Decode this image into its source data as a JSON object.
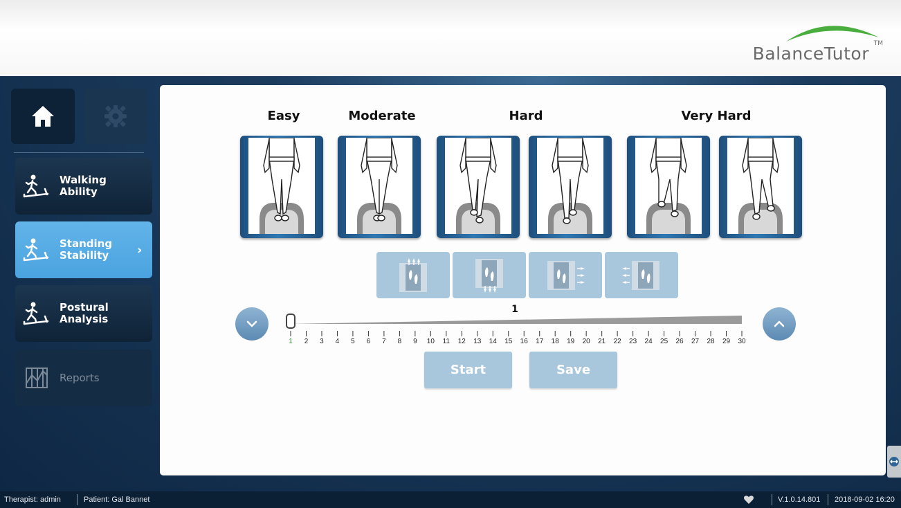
{
  "brand": {
    "name": "BalanceTutor",
    "trademark": "TM",
    "accent": "#3aa33a"
  },
  "sidebar": {
    "home_icon": "home-icon",
    "settings_icon": "gear-icon",
    "items": [
      {
        "label": "Walking Ability",
        "icon": "treadmill-icon",
        "state": "normal"
      },
      {
        "label": "Standing Stability",
        "icon": "treadmill-icon",
        "state": "active",
        "chevron": "›"
      },
      {
        "label": "Postural Analysis",
        "icon": "treadmill-icon",
        "state": "normal"
      },
      {
        "label": "Reports",
        "icon": "chart-icon",
        "state": "disabled"
      }
    ]
  },
  "levels": {
    "titles": [
      "Easy",
      "Moderate",
      "Hard",
      "Very Hard"
    ],
    "cards": [
      {
        "label": "easy-stance-card"
      },
      {
        "label": "moderate-stance-card"
      },
      {
        "label": "hard-stance-card-1"
      },
      {
        "label": "hard-stance-card-2"
      },
      {
        "label": "very-hard-stance-card-1"
      },
      {
        "label": "very-hard-stance-card-2"
      }
    ]
  },
  "directions": [
    "forward",
    "backward",
    "right",
    "left"
  ],
  "slider": {
    "value": "1",
    "min": 1,
    "max": 30,
    "ticks": [
      "1",
      "2",
      "3",
      "4",
      "5",
      "6",
      "7",
      "8",
      "9",
      "10",
      "11",
      "12",
      "13",
      "14",
      "15",
      "16",
      "17",
      "18",
      "19",
      "20",
      "21",
      "22",
      "23",
      "24",
      "25",
      "26",
      "27",
      "28",
      "29",
      "30"
    ],
    "selected_tick_color": "#2e8b2e"
  },
  "actions": {
    "start_label": "Start",
    "save_label": "Save"
  },
  "status": {
    "therapist": "Therapist: admin",
    "patient": "Patient: Gal Bannet",
    "version": "V.1.0.14.801",
    "datetime": "2018-09-02 16:20"
  }
}
